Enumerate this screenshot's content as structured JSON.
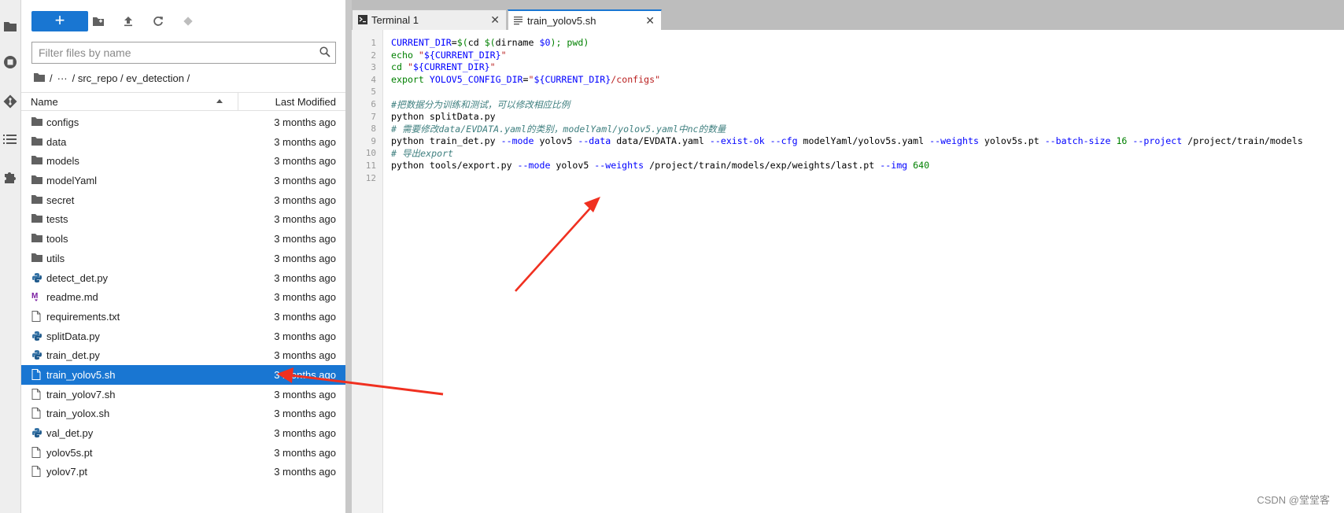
{
  "sidebar_icons": [
    "folder-icon",
    "running-icon",
    "git-icon",
    "toc-icon",
    "extension-icon"
  ],
  "toolbar": {
    "new_label": "+"
  },
  "filter": {
    "placeholder": "Filter files by name"
  },
  "breadcrumb": {
    "root": "/",
    "ellipsis": "···",
    "path": "/ src_repo / ev_detection /"
  },
  "columns": {
    "name": "Name",
    "modified": "Last Modified"
  },
  "files": [
    {
      "name": "configs",
      "modified": "3 months ago",
      "type": "folder"
    },
    {
      "name": "data",
      "modified": "3 months ago",
      "type": "folder"
    },
    {
      "name": "models",
      "modified": "3 months ago",
      "type": "folder"
    },
    {
      "name": "modelYaml",
      "modified": "3 months ago",
      "type": "folder"
    },
    {
      "name": "secret",
      "modified": "3 months ago",
      "type": "folder"
    },
    {
      "name": "tests",
      "modified": "3 months ago",
      "type": "folder"
    },
    {
      "name": "tools",
      "modified": "3 months ago",
      "type": "folder"
    },
    {
      "name": "utils",
      "modified": "3 months ago",
      "type": "folder"
    },
    {
      "name": "detect_det.py",
      "modified": "3 months ago",
      "type": "python"
    },
    {
      "name": "readme.md",
      "modified": "3 months ago",
      "type": "markdown"
    },
    {
      "name": "requirements.txt",
      "modified": "3 months ago",
      "type": "file"
    },
    {
      "name": "splitData.py",
      "modified": "3 months ago",
      "type": "python"
    },
    {
      "name": "train_det.py",
      "modified": "3 months ago",
      "type": "python"
    },
    {
      "name": "train_yolov5.sh",
      "modified": "3 months ago",
      "type": "file",
      "selected": true
    },
    {
      "name": "train_yolov7.sh",
      "modified": "3 months ago",
      "type": "file"
    },
    {
      "name": "train_yolox.sh",
      "modified": "3 months ago",
      "type": "file"
    },
    {
      "name": "val_det.py",
      "modified": "3 months ago",
      "type": "python"
    },
    {
      "name": "yolov5s.pt",
      "modified": "3 months ago",
      "type": "file"
    },
    {
      "name": "yolov7.pt",
      "modified": "3 months ago",
      "type": "file"
    }
  ],
  "tabs": [
    {
      "label": "Terminal 1",
      "close": "✕"
    },
    {
      "label": "train_yolov5.sh",
      "close": "✕"
    }
  ],
  "code_lines": [
    [
      [
        "var",
        "CURRENT_DIR"
      ],
      [
        "",
        "="
      ],
      [
        "kw",
        "$("
      ],
      [
        "",
        "cd "
      ],
      [
        "kw",
        "$("
      ],
      [
        "",
        "dirname "
      ],
      [
        "var",
        "$0"
      ],
      [
        "kw",
        ");"
      ],
      [
        "",
        ""
      ],
      [
        "kw",
        " pwd)"
      ]
    ],
    [
      [
        "kw",
        "echo "
      ],
      [
        "str",
        "\""
      ],
      [
        "var",
        "${CURRENT_DIR}"
      ],
      [
        "str",
        "\""
      ]
    ],
    [
      [
        "kw",
        "cd "
      ],
      [
        "str",
        "\""
      ],
      [
        "var",
        "${CURRENT_DIR}"
      ],
      [
        "str",
        "\""
      ]
    ],
    [
      [
        "kw",
        "export "
      ],
      [
        "var",
        "YOLOV5_CONFIG_DIR"
      ],
      [
        "",
        "="
      ],
      [
        "str",
        "\""
      ],
      [
        "var",
        "${CURRENT_DIR}"
      ],
      [
        "str",
        "/configs\""
      ]
    ],
    [],
    [
      [
        "cm",
        "#把数据分为训练和测试，可以修改相应比例"
      ]
    ],
    [
      [
        "",
        "python splitData.py"
      ]
    ],
    [
      [
        "cm",
        "# 需要修改data/EVDATA.yaml的类别，modelYaml/yolov5.yaml中nc的数量"
      ]
    ],
    [
      [
        "",
        "python train_det.py "
      ],
      [
        "flag",
        "--mode"
      ],
      [
        "",
        " yolov5 "
      ],
      [
        "flag",
        "--data"
      ],
      [
        "",
        " data/EVDATA.yaml "
      ],
      [
        "flag",
        "--exist-ok"
      ],
      [
        "",
        " "
      ],
      [
        "flag",
        "--cfg"
      ],
      [
        "",
        " modelYaml/yolov5s.yaml "
      ],
      [
        "flag",
        "--weights"
      ],
      [
        "",
        " yolov5s.pt "
      ],
      [
        "flag",
        "--batch-size"
      ],
      [
        "",
        " "
      ],
      [
        "num",
        "16"
      ],
      [
        "",
        " "
      ],
      [
        "flag",
        "--project"
      ],
      [
        "",
        " /project/train/models"
      ]
    ],
    [
      [
        "cm",
        "# 导出export"
      ]
    ],
    [
      [
        "",
        "python tools/export.py "
      ],
      [
        "flag",
        "--mode"
      ],
      [
        "",
        " yolov5 "
      ],
      [
        "flag",
        "--weights"
      ],
      [
        "",
        " /project/train/models/exp/weights/last.pt "
      ],
      [
        "flag",
        "--img"
      ],
      [
        "",
        " "
      ],
      [
        "num",
        "640"
      ]
    ],
    []
  ],
  "watermark": "CSDN @堂堂客",
  "colors": {
    "accent": "#1976d2",
    "annotation_arrow": "#f03020"
  }
}
